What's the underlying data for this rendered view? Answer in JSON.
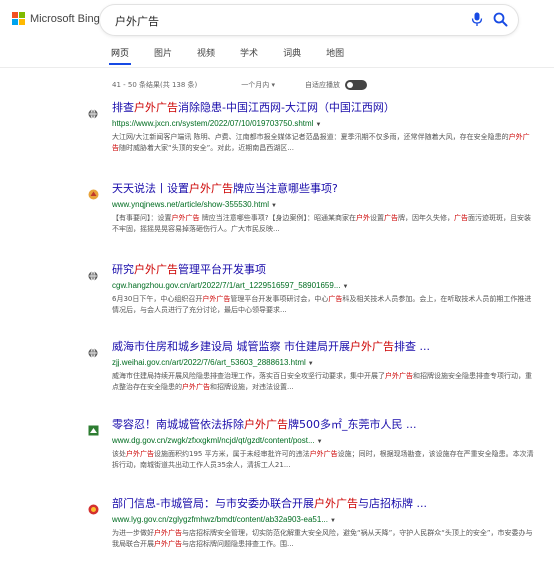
{
  "header": {
    "logo_text": "Microsoft Bing",
    "query": "户外广告",
    "tabs": [
      "网页",
      "图片",
      "视频",
      "学术",
      "词典",
      "地图"
    ]
  },
  "toolbar": {
    "result_count": "41 - 50 条结果(共 138 条)",
    "time_filter": "一个月内 ▾",
    "autoplay_label": "自适应播放"
  },
  "colors": {
    "link": "#1a0dab",
    "url": "#006d21",
    "highlight": "#cc0000",
    "tab_underline": "#174ae4"
  },
  "results": [
    {
      "icon": "globe-icon",
      "title_parts": [
        "排查",
        "户外广告",
        "消除隐患-中国江西网-大江网（中国江西网）"
      ],
      "url": "https://www.jxcn.cn/system/2022/07/10/019703750.shtml",
      "snippet_parts": [
        "大江网/大江新闻客户端讯 陈明、卢费、江南都市报全媒体记者范晶报道：夏季汛期不仅多雨，还常伴随着大风，存在安全隐患的",
        "户外广告",
        "随时威胁着大家“头顶的安全”。对此，近期南昌西湖区..."
      ]
    },
    {
      "icon": "site-icon",
      "title_parts": [
        "天天说法丨设置",
        "户外广告",
        "牌应当注意哪些事项?"
      ],
      "url": "www.ynqjnews.net/article/show-355530.html",
      "snippet_parts": [
        "【有事要问】：设置",
        "户外广告",
        " 牌应当注意哪些事项?【身边案例】：昭通某商家在",
        "户外",
        "设置",
        "广告",
        "牌，因年久失修，",
        "广告",
        "面污迹斑斑，且安装不牢固，摇摇晃晃容易掉落砸伤行人。广大市民反映..."
      ]
    },
    {
      "icon": "globe-icon",
      "title_parts": [
        "研究",
        "户外广告",
        "管理平台开发事项"
      ],
      "url": "cgw.hangzhou.gov.cn/art/2022/7/1/art_1229516597_58901659...",
      "snippet_parts": [
        "6月30日下午，中心组织召开",
        "户外广告",
        "管理平台开发事项研讨会，中心",
        "广告",
        "科及相关技术人员参加。会上，在听取技术人员前期工作推进情况后，与会人员进行了充分讨论，最后中心领导要求..."
      ]
    },
    {
      "icon": "globe-icon",
      "title_parts": [
        "威海市住房和城乡建设局 城管监察 市住建局开展",
        "户外广告",
        "排查 ..."
      ],
      "url": "zjj.weihai.gov.cn/art/2022/7/6/art_53603_2888613.html",
      "snippet_parts": [
        "威海市住建局持续开展风险隐患排查治理工作，落实百日安全攻坚行动要求，集中开展了",
        "户外广告",
        "和招牌设施安全隐患排查专项行动，重点整治存在安全隐患的",
        "户外广告",
        "和招牌设施，对违法设置..."
      ]
    },
    {
      "icon": "site-icon",
      "title_parts": [
        "零容忍！南城城管依法拆除",
        "户外广告",
        "牌500多㎡_东莞市人民 ..."
      ],
      "url": "www.dg.gov.cn/zwgk/zfxxgkml/ncjd/qt/gzdt/content/post...",
      "snippet_parts": [
        "该处",
        "户外广告",
        "设施面积约195 平方米，属于未经审批许可的违法",
        "户外广告",
        "设施；同时，根据现场勘查，该设施存在严重安全隐患。本次清拆行动，南城街道共出动工作人员35余人，清拆工人21..."
      ]
    },
    {
      "icon": "emblem-icon",
      "title_parts": [
        "部门信息-市城管局：与市安委办联合开展",
        "户外广告",
        "与店招标牌 ..."
      ],
      "url": "www.lyg.gov.cn/zglygzfmhwz/bmdt/content/ab32a903-ea51...",
      "snippet_parts": [
        "为进一步做好",
        "户外广告",
        "与店招标牌安全管理，切实防范化解重大安全风险，避免“祸从天降”，守护人民群众“头顶上的安全”，市安委办与我局联合开展",
        "户外广告",
        "与店招标牌问题隐患排查工作。围..."
      ]
    }
  ]
}
